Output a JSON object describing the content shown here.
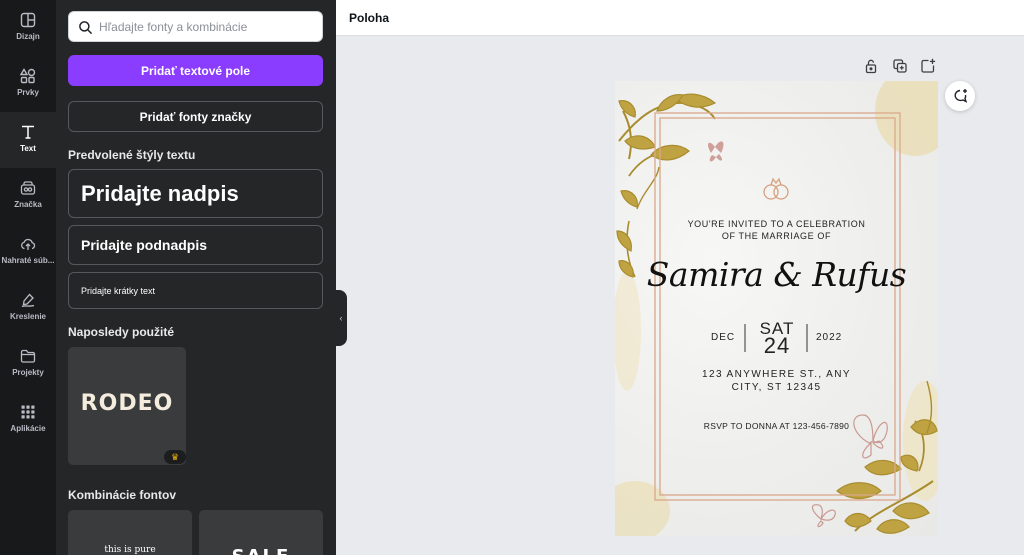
{
  "rail": {
    "items": [
      {
        "label": "Dizajn",
        "icon": "layout-icon"
      },
      {
        "label": "Prvky",
        "icon": "shapes-icon"
      },
      {
        "label": "Text",
        "icon": "text-icon"
      },
      {
        "label": "Značka",
        "icon": "brand-icon"
      },
      {
        "label": "Nahraté súb...",
        "icon": "cloud-upload-icon"
      },
      {
        "label": "Kreslenie",
        "icon": "draw-icon"
      },
      {
        "label": "Projekty",
        "icon": "folder-icon"
      },
      {
        "label": "Aplikácie",
        "icon": "apps-grid-icon"
      }
    ],
    "active": "Text"
  },
  "panel": {
    "search_placeholder": "Hľadajte fonty a kombinácie",
    "add_text_button": "Pridať textové pole",
    "brand_fonts_button": "Pridať fonty značky",
    "default_styles_title": "Predvolené štýly textu",
    "heading_style": "Pridajte nadpis",
    "subheading_style": "Pridajte podnadpis",
    "body_style": "Pridajte krátky text",
    "recent_title": "Naposledy použité",
    "recent_font": "RODEO",
    "combos_title": "Kombinácie fontov",
    "combo_1_text": "this is pure",
    "combo_2_text": "SALE"
  },
  "topbar": {
    "title": "Poloha"
  },
  "invitation": {
    "line_1": "YOU'RE INVITED TO A CELEBRATION",
    "line_2": "OF THE MARRIAGE OF",
    "names": "Samira & Rufus",
    "month": "DEC",
    "weekday": "SAT",
    "day": "24",
    "year": "2022",
    "address_1": "123 ANYWHERE ST., ANY",
    "address_2": "CITY, ST 12345",
    "rsvp": "RSVP TO DONNA AT 123-456-7890"
  },
  "colors": {
    "accent": "#8b3dff",
    "panel": "#252627",
    "rail": "#18191b",
    "gold": "#c9a227",
    "frame": "#d9a88a"
  }
}
